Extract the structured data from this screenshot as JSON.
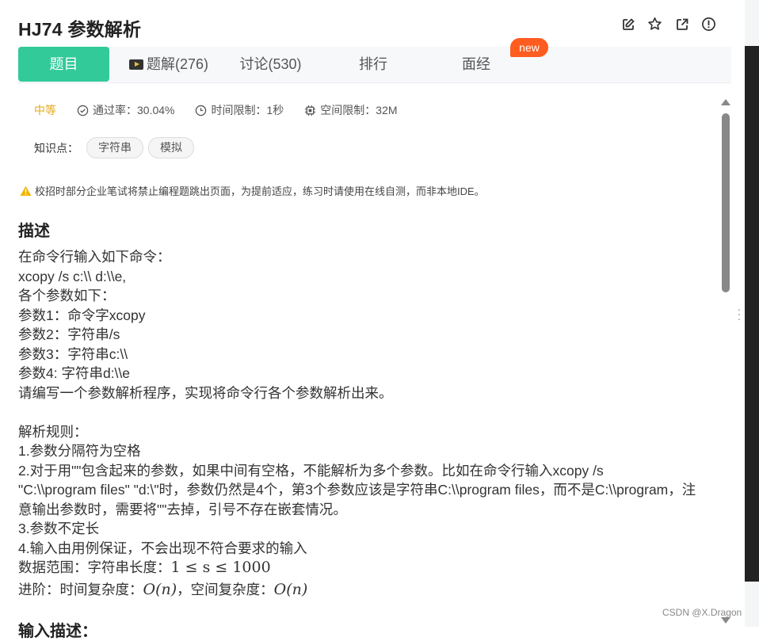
{
  "problem": {
    "title": "HJ74  参数解析"
  },
  "header_icons": [
    "edit-icon",
    "star-icon",
    "external-link-icon",
    "alert-circle-icon"
  ],
  "tabs": [
    {
      "label": "题目",
      "active": true
    },
    {
      "label": "题解(276)",
      "icon": "video-icon"
    },
    {
      "label": "讨论(530)"
    },
    {
      "label": "排行"
    },
    {
      "label": "面经",
      "badge": "new"
    }
  ],
  "meta": {
    "difficulty": "中等",
    "pass_rate": "通过率：30.04%",
    "time_limit": "时间限制：1秒",
    "space_limit": "空间限制：32M"
  },
  "knowledge": {
    "label": "知识点：",
    "tags": [
      "字符串",
      "模拟"
    ]
  },
  "warning": "校招时部分企业笔试将禁止编程题跳出页面，为提前适应，练习时请使用在线自测，而非本地IDE。",
  "description": {
    "heading": "描述",
    "lines": [
      "在命令行输入如下命令：",
      "xcopy /s c:\\\\ d:\\\\e,",
      "各个参数如下：",
      "参数1：命令字xcopy",
      "参数2：字符串/s",
      "参数3：字符串c:\\\\",
      "参数4: 字符串d:\\\\e",
      "请编写一个参数解析程序，实现将命令行各个参数解析出来。",
      "",
      "解析规则：",
      "1.参数分隔符为空格",
      "2.对于用\"\"包含起来的参数，如果中间有空格，不能解析为多个参数。比如在命令行输入xcopy /s",
      "\"C:\\\\program files\" \"d:\\\"时，参数仍然是4个，第3个参数应该是字符串C:\\\\program files，而不是C:\\\\program，注",
      "意输出参数时，需要将\"\"去掉，引号不存在嵌套情况。",
      "3.参数不定长",
      "4.输入由用例保证，不会出现不符合要求的输入"
    ],
    "range_label": "数据范围：字符串长度：",
    "range_math": "1 ≤ s ≤ 1000",
    "advanced_label": "进阶：时间复杂度：",
    "time_complexity": "O(n)",
    "space_label": "，空间复杂度：",
    "space_complexity": "O(n)"
  },
  "next_heading": "输入描述：",
  "watermark": "CSDN @X.Dragon",
  "colors": {
    "accent": "#32ca99",
    "difficulty": "#e6a817",
    "badge": "#ff5c1f"
  }
}
